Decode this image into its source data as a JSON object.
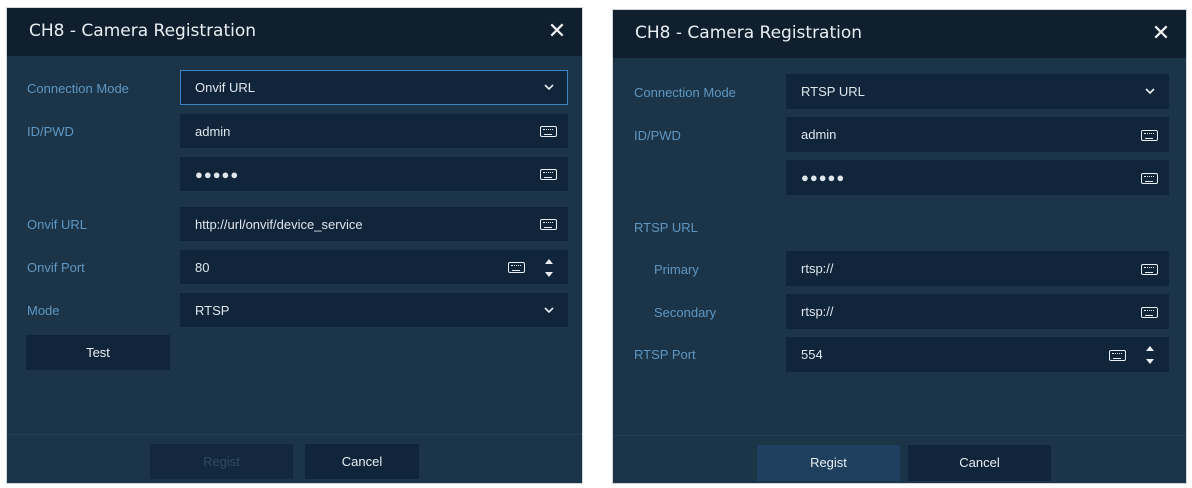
{
  "left": {
    "title": "CH8 - Camera Registration",
    "close_icon": "close-icon",
    "rows": {
      "connection_mode": {
        "label": "Connection Mode",
        "value": "Onvif URL"
      },
      "id_pwd": {
        "label": "ID/PWD",
        "id_value": "admin",
        "pwd_value": "●●●●●"
      },
      "onvif_url": {
        "label": "Onvif URL",
        "value": "http://url/onvif/device_service"
      },
      "onvif_port": {
        "label": "Onvif Port",
        "value": "80"
      },
      "mode": {
        "label": "Mode",
        "value": "RTSP"
      }
    },
    "test_button": "Test",
    "regist_button": "Regist",
    "cancel_button": "Cancel"
  },
  "right": {
    "title": "CH8 - Camera Registration",
    "close_icon": "close-icon",
    "rows": {
      "connection_mode": {
        "label": "Connection Mode",
        "value": "RTSP URL"
      },
      "id_pwd": {
        "label": "ID/PWD",
        "id_value": "admin",
        "pwd_value": "●●●●●"
      },
      "rtsp_url": {
        "label": "RTSP URL"
      },
      "primary": {
        "label": "Primary",
        "value": "rtsp://"
      },
      "secondary": {
        "label": "Secondary",
        "value": "rtsp://"
      },
      "rtsp_port": {
        "label": "RTSP Port",
        "value": "554"
      }
    },
    "regist_button": "Regist",
    "cancel_button": "Cancel"
  },
  "colors": {
    "dialog_bg": "#1c3447",
    "titlebar_bg": "#0f1f2e",
    "field_bg": "#11253a",
    "label": "#5e97c3",
    "focus_border": "#3a83c6"
  }
}
